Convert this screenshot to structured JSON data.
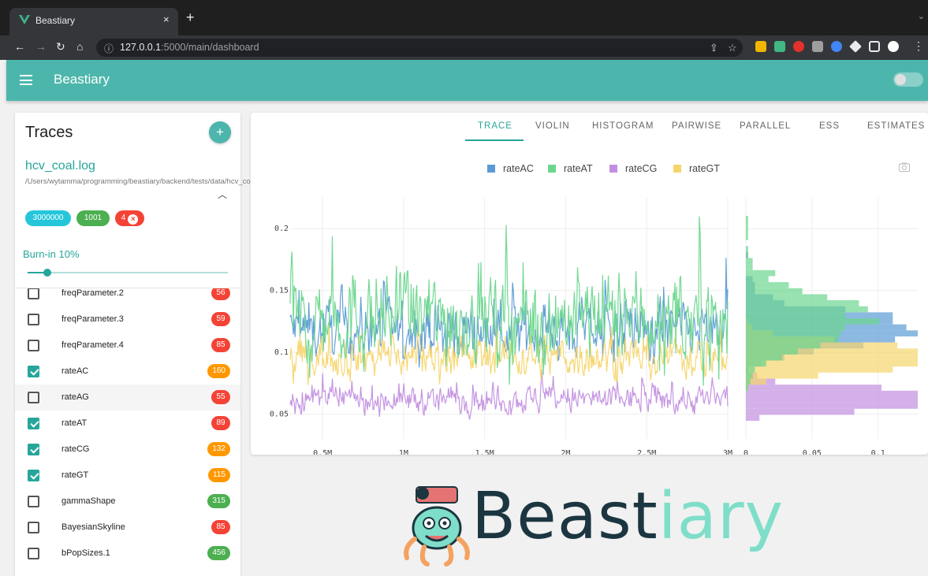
{
  "browser": {
    "tab_title": "Beastiary",
    "tab_close": "×",
    "new_tab": "+",
    "url_host": "127.0.0.1",
    "url_path": ":5000/main/dashboard"
  },
  "app": {
    "title": "Beastiary",
    "accent": "#4db6ac"
  },
  "sidebar": {
    "title": "Traces",
    "add_button": "+",
    "file": {
      "name": "hcv_coal.log",
      "path": "/Users/wytamma/programming/beastiary/backend/tests/data/hcv_coal.log"
    },
    "chips": [
      {
        "label": "3000000",
        "color": "#26c6da"
      },
      {
        "label": "1001",
        "color": "#4caf50"
      },
      {
        "label": "4",
        "color": "#f44336"
      }
    ],
    "burnin_label": "Burn-in 10%",
    "burnin_value": 0.1,
    "parameters": [
      {
        "label": "freqParameter.2",
        "checked": false,
        "badge": "56",
        "badge_color": "#f44336"
      },
      {
        "label": "freqParameter.3",
        "checked": false,
        "badge": "59",
        "badge_color": "#f44336"
      },
      {
        "label": "freqParameter.4",
        "checked": false,
        "badge": "85",
        "badge_color": "#f44336"
      },
      {
        "label": "rateAC",
        "checked": true,
        "badge": "160",
        "badge_color": "#ff9800"
      },
      {
        "label": "rateAG",
        "checked": false,
        "badge": "55",
        "badge_color": "#f44336"
      },
      {
        "label": "rateAT",
        "checked": true,
        "badge": "89",
        "badge_color": "#f44336"
      },
      {
        "label": "rateCG",
        "checked": true,
        "badge": "132",
        "badge_color": "#ff9800"
      },
      {
        "label": "rateGT",
        "checked": true,
        "badge": "115",
        "badge_color": "#ff9800"
      },
      {
        "label": "gammaShape",
        "checked": false,
        "badge": "315",
        "badge_color": "#4caf50"
      },
      {
        "label": "BayesianSkyline",
        "checked": false,
        "badge": "85",
        "badge_color": "#f44336"
      },
      {
        "label": "bPopSizes.1",
        "checked": false,
        "badge": "456",
        "badge_color": "#4caf50"
      }
    ]
  },
  "tabs": [
    "TRACE",
    "VIOLIN",
    "HISTOGRAM",
    "PAIRWISE",
    "PARALLEL",
    "ESS",
    "ESTIMATES"
  ],
  "active_tab": "TRACE",
  "chart_data": {
    "type": "line",
    "series": [
      {
        "name": "rateAC",
        "color": "#5b9bd5",
        "center": 0.118,
        "spread": 0.022
      },
      {
        "name": "rateAT",
        "color": "#6bd68e",
        "center": 0.128,
        "spread": 0.035
      },
      {
        "name": "rateCG",
        "color": "#c28fe0",
        "center": 0.062,
        "spread": 0.011
      },
      {
        "name": "rateGT",
        "color": "#f5d56b",
        "center": 0.097,
        "spread": 0.016
      }
    ],
    "xlim": [
      0.3,
      3.0
    ],
    "ylim": [
      0.03,
      0.225
    ],
    "x_ticks": [
      "0.5M",
      "1M",
      "1.5M",
      "2M",
      "2.5M",
      "3M"
    ],
    "x_tick_values": [
      0.5,
      1.0,
      1.5,
      2.0,
      2.5,
      3.0
    ],
    "y_ticks": [
      "0.05",
      "0.1",
      "0.15",
      "0.2"
    ],
    "y_tick_values": [
      0.05,
      0.1,
      0.15,
      0.2
    ],
    "hist_x_ticks": [
      "0",
      "0.05",
      "0.1"
    ],
    "hist_x_tick_values": [
      0,
      0.05,
      0.1
    ],
    "hist_xlim": [
      0,
      0.13
    ]
  },
  "logo": {
    "text_dark": "Beast",
    "text_light": "iary"
  }
}
